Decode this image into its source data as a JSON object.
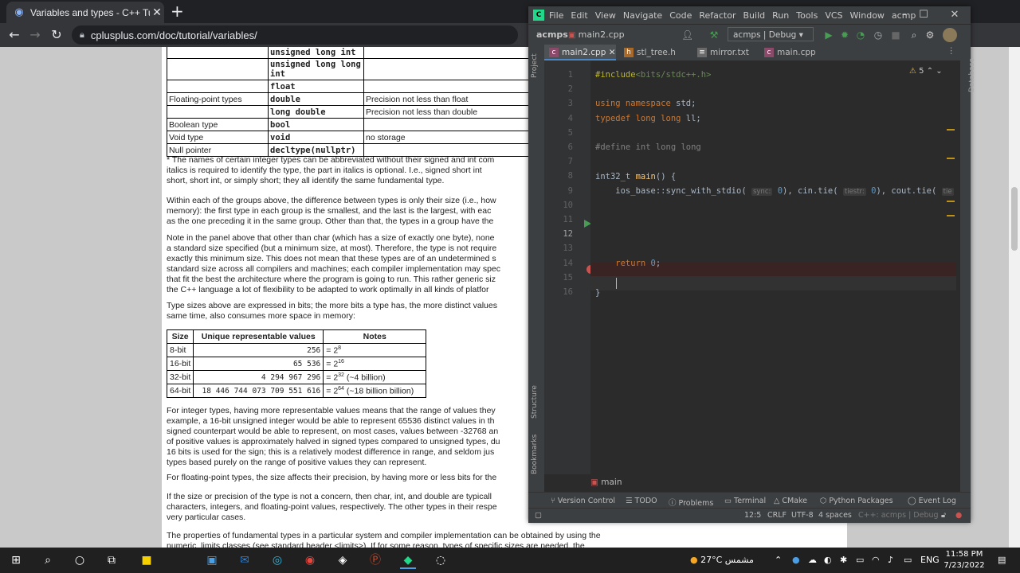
{
  "browser": {
    "tab_title": "Variables and types - C++ Tutori",
    "url": "cplusplus.com/doc/tutorial/variables/"
  },
  "doc": {
    "types_table": [
      {
        "group": "",
        "type": "unsigned long int",
        "note": ""
      },
      {
        "group": "",
        "type": "unsigned long long int",
        "note": ""
      },
      {
        "group": "",
        "type": "float",
        "note": ""
      },
      {
        "group": "Floating-point types",
        "type": "double",
        "note": "Precision not less than float"
      },
      {
        "group": "",
        "type": "long double",
        "note": "Precision not less than double"
      },
      {
        "group": "Boolean type",
        "type": "bool",
        "note": ""
      },
      {
        "group": "Void type",
        "type": "void",
        "note": "no storage"
      },
      {
        "group": "Null pointer",
        "type": "decltype(nullptr)",
        "note": ""
      }
    ],
    "p1": [
      "* The names of certain integer types can be abbreviated without their signed and int com",
      "italics is required to identify the type, the part in italics is optional. I.e., signed short int",
      "short, short int, or simply short; they all identify the same fundamental type."
    ],
    "p2": [
      "Within each of the groups above, the difference between types is only their size (i.e., how",
      "memory): the first type in each group is the smallest, and the last is the largest, with eac",
      "as the one preceding it in the same group. Other than that, the types in a group have the"
    ],
    "p3": [
      "Note in the panel above that other than char (which has a size of exactly one byte), none",
      "a standard size specified (but a minimum size, at most). Therefore, the type is not require",
      "exactly this minimum size. This does not mean that these types are of an undetermined s",
      "standard size across all compilers and machines; each compiler implementation may spec",
      "that fit the best the architecture where the program is going to run. This rather generic siz",
      "the C++ language a lot of flexibility to be adapted to work optimally in all kinds of platfor"
    ],
    "p4": [
      "Type sizes above are expressed in bits; the more bits a type has, the more distinct values",
      "same time, also consumes more space in memory:"
    ],
    "size_table": {
      "headers": [
        "Size",
        "Unique representable values",
        "Notes"
      ],
      "rows": [
        {
          "size": "8-bit",
          "values": "256",
          "base": "= 2",
          "exp": "8",
          "tail": ""
        },
        {
          "size": "16-bit",
          "values": "65 536",
          "base": "= 2",
          "exp": "16",
          "tail": ""
        },
        {
          "size": "32-bit",
          "values": "4 294 967 296",
          "base": "= 2",
          "exp": "32",
          "tail": " (~4 billion)"
        },
        {
          "size": "64-bit",
          "values": "18 446 744 073 709 551 616",
          "base": "= 2",
          "exp": "64",
          "tail": " (~18 billion billion)"
        }
      ]
    },
    "p5": [
      "For integer types, having more representable values means that the range of values they",
      "example, a 16-bit unsigned integer would be able to represent 65536 distinct values in th",
      "signed counterpart would be able to represent, on most cases, values between -32768 an",
      "of positive values is approximately halved in signed types compared to unsigned types, du",
      "16 bits is used for the sign; this is a relatively modest difference in range, and seldom jus",
      "types based purely on the range of positive values they can represent."
    ],
    "p6": [
      "For floating-point types, the size affects their precision, by having more or less bits for the"
    ],
    "p7": [
      "If the size or precision of the type is not a concern, then char, int, and double are typicall",
      "characters, integers, and floating-point values, respectively. The other types in their respe",
      "very particular cases."
    ],
    "p8": [
      "The properties of fundamental types in a particular system and compiler implementation can be obtained by using the",
      "numeric_limits classes (see standard header <limits>). If for some reason, types of specific sizes are needed, the"
    ]
  },
  "ide": {
    "menu": [
      "File",
      "Edit",
      "View",
      "Navigate",
      "Code",
      "Refactor",
      "Build",
      "Run",
      "Tools",
      "VCS",
      "Window",
      "acmp"
    ],
    "project": "acmps",
    "current_file": "main2.cpp",
    "run_config": "acmps | Debug",
    "tabs": [
      "main2.cpp",
      "stl_tree.h",
      "mirror.txt",
      "main.cpp"
    ],
    "warning_count": "5",
    "line_numbers": [
      "1",
      "2",
      "3",
      "4",
      "5",
      "6",
      "7",
      "8",
      "9",
      "10",
      "11",
      "12",
      "13",
      "14",
      "15",
      "16"
    ],
    "code": {
      "l1_a": "#include",
      "l1_b": "<bits/stdc++.h>",
      "l3_a": "using namespace",
      "l3_b": " std;",
      "l4_a": "typedef long long",
      "l4_b": " ll;",
      "l6": "#define int long long",
      "l8_a": "int32_t ",
      "l8_b": "main",
      "l8_c": "() {",
      "l9_a": "    ios_base::sync_with_stdio( ",
      "l9_h1": "sync:",
      "l9_v1": "0",
      "l9_b": "), cin.tie( ",
      "l9_h2": "tiestr:",
      "l9_v2": "0",
      "l9_c": "), cout.tie( ",
      "l9_h3": "tie",
      "l14_a": "    return ",
      "l14_b": "0",
      "l14_c": ";",
      "l16": "}"
    },
    "breadcrumb": "main",
    "left_tools": [
      "Project",
      "Structure",
      "Bookmarks"
    ],
    "right_tools": [
      "Database"
    ],
    "bottom_tools": [
      "Version Control",
      "TODO",
      "Problems",
      "Terminal",
      "CMake",
      "Python Packages",
      "Event Log"
    ],
    "status": {
      "pos": "12:5",
      "eol": "CRLF",
      "enc": "UTF-8",
      "indent": "4 spaces",
      "ctx": "C++: acmps | Debug"
    }
  },
  "taskbar": {
    "weather": "27°C  مشمس",
    "lang": "ENG",
    "time": "11:58 PM",
    "date": "7/23/2022"
  },
  "colors": {
    "accent": "#4a88c7",
    "breakpoint": "#c75450",
    "run": "#499c54"
  }
}
